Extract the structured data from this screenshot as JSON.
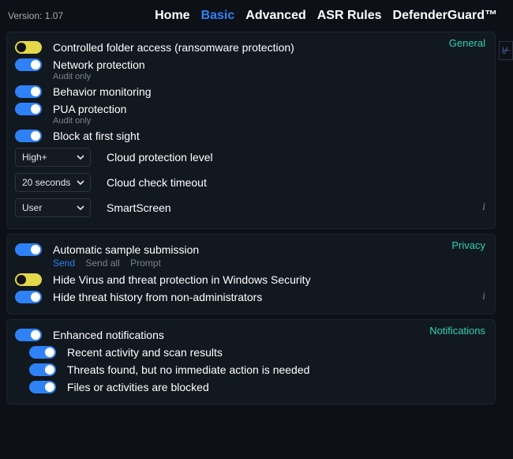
{
  "version_label": "Version: 1.07",
  "nav": {
    "home": "Home",
    "basic": "Basic",
    "advanced": "Advanced",
    "asr": "ASR Rules",
    "defender": "DefenderGuard™"
  },
  "sections": {
    "general": {
      "title": "General",
      "controlled_folder": "Controlled folder access (ransomware protection)",
      "network_protection": "Network protection",
      "network_protection_note": "Audit only",
      "behavior_monitoring": "Behavior monitoring",
      "pua_protection": "PUA protection",
      "pua_protection_note": "Audit only",
      "block_first_sight": "Block at first sight",
      "cloud_level": {
        "value": "High+",
        "label": "Cloud protection level"
      },
      "cloud_timeout": {
        "value": "20 seconds",
        "label": "Cloud check timeout"
      },
      "smartscreen": {
        "value": "User",
        "label": "SmartScreen"
      }
    },
    "privacy": {
      "title": "Privacy",
      "auto_submit": "Automatic sample submission",
      "links": {
        "send": "Send",
        "send_all": "Send all",
        "prompt": "Prompt"
      },
      "hide_virus": "Hide Virus and threat protection in Windows Security",
      "hide_history": "Hide threat history from non-administrators"
    },
    "notifications": {
      "title": "Notifications",
      "enhanced": "Enhanced notifications",
      "recent": "Recent activity and scan results",
      "threats_found": "Threats found, but no immediate action is needed",
      "blocked": "Files or activities are blocked"
    }
  }
}
